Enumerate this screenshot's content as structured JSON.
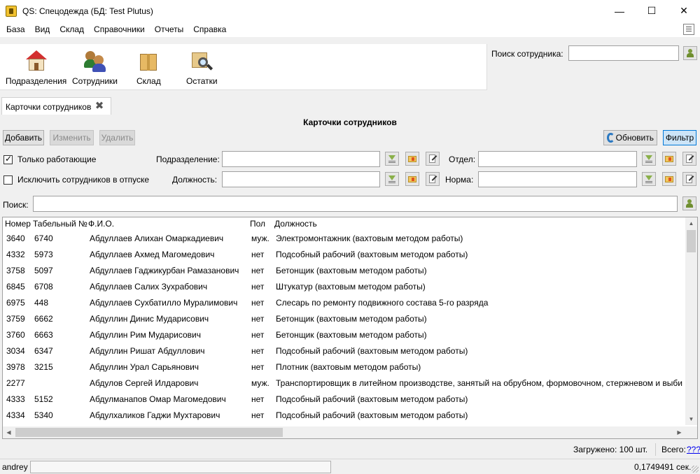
{
  "window": {
    "title": "QS: Спецодежда (БД: Test Plutus)",
    "minimize": "—",
    "maximize": "☐",
    "close": "✕"
  },
  "menu": [
    "База",
    "Вид",
    "Склад",
    "Справочники",
    "Отчеты",
    "Справка"
  ],
  "toolbar": {
    "items": [
      {
        "label": "Подразделения",
        "icon": "house-icon"
      },
      {
        "label": "Сотрудники",
        "icon": "people-icon"
      },
      {
        "label": "Склад",
        "icon": "box-icon"
      },
      {
        "label": "Остатки",
        "icon": "search-box-icon"
      }
    ],
    "search_label": "Поиск сотрудника:",
    "search_value": ""
  },
  "tab": {
    "label": "Карточки сотрудников"
  },
  "panel": {
    "title": "Карточки сотрудников",
    "buttons": {
      "add": "Добавить",
      "edit": "Изменить",
      "delete": "Удалить",
      "refresh": "Обновить",
      "filter": "Фильтр"
    },
    "filters": {
      "only_working": {
        "label": "Только работающие",
        "checked": true
      },
      "exclude_vacation": {
        "label": "Исключить сотрудников в отпуске",
        "checked": false
      },
      "division_label": "Подразделение:",
      "division_value": "",
      "department_label": "Отдел:",
      "department_value": "",
      "position_label": "Должность:",
      "position_value": "",
      "norm_label": "Норма:",
      "norm_value": ""
    },
    "search_label": "Поиск:",
    "search_value": ""
  },
  "table": {
    "columns": [
      "Номер",
      "Табельный №",
      "Ф.И.О.",
      "Пол",
      "Должность"
    ],
    "rows": [
      {
        "num": "3640",
        "tab": "6740",
        "name": "Абдуллаев Алихан Омаркадиевич",
        "sex": "муж.",
        "pos": "Электромонтажник (вахтовым методом работы)"
      },
      {
        "num": "4332",
        "tab": "5973",
        "name": "Абдуллаев Ахмед Магомедович",
        "sex": "нет",
        "pos": "Подсобный рабочий (вахтовым методом работы)"
      },
      {
        "num": "3758",
        "tab": "5097",
        "name": "Абдуллаев Гаджикурбан Рамазанович",
        "sex": "нет",
        "pos": "Бетонщик (вахтовым методом работы)"
      },
      {
        "num": "6845",
        "tab": "6708",
        "name": "Абдуллаев Салих Зухрабович",
        "sex": "нет",
        "pos": "Штукатур (вахтовым методом работы)"
      },
      {
        "num": "6975",
        "tab": "448",
        "name": "Абдуллаев Сухбатилло Муралимович",
        "sex": "нет",
        "pos": "Слесарь по ремонту подвижного состава 5-го разряда"
      },
      {
        "num": "3759",
        "tab": "6662",
        "name": "Абдуллин Динис Мударисович",
        "sex": "нет",
        "pos": "Бетонщик (вахтовым методом работы)"
      },
      {
        "num": "3760",
        "tab": "6663",
        "name": "Абдуллин Рим Мударисович",
        "sex": "нет",
        "pos": "Бетонщик (вахтовым методом работы)"
      },
      {
        "num": "3034",
        "tab": "6347",
        "name": "Абдуллин Ришат Абдуллович",
        "sex": "нет",
        "pos": "Подсобный рабочий (вахтовым методом работы)"
      },
      {
        "num": "3978",
        "tab": "3215",
        "name": "Абдуллин Урал Сарьянович",
        "sex": "нет",
        "pos": "Плотник (вахтовым методом работы)"
      },
      {
        "num": "2277",
        "tab": "",
        "name": "Абдулов Сергей Илдарович",
        "sex": "муж.",
        "pos": "Транспортировщик в литейном производстве, занятый на обрубном, формовочном, стержневом и выби"
      },
      {
        "num": "4333",
        "tab": "5152",
        "name": "Абдулманапов Омар Магомедович",
        "sex": "нет",
        "pos": "Подсобный рабочий (вахтовым методом работы)"
      },
      {
        "num": "4334",
        "tab": "5340",
        "name": "Абдулхаликов Гаджи Мухтарович",
        "sex": "нет",
        "pos": "Подсобный рабочий (вахтовым методом работы)"
      }
    ]
  },
  "summary": {
    "loaded": "Загружено: 100 шт.",
    "total_label": "Всего:",
    "total_link": "???"
  },
  "status": {
    "user": "andrey",
    "timing": "0,1749491 сек."
  }
}
